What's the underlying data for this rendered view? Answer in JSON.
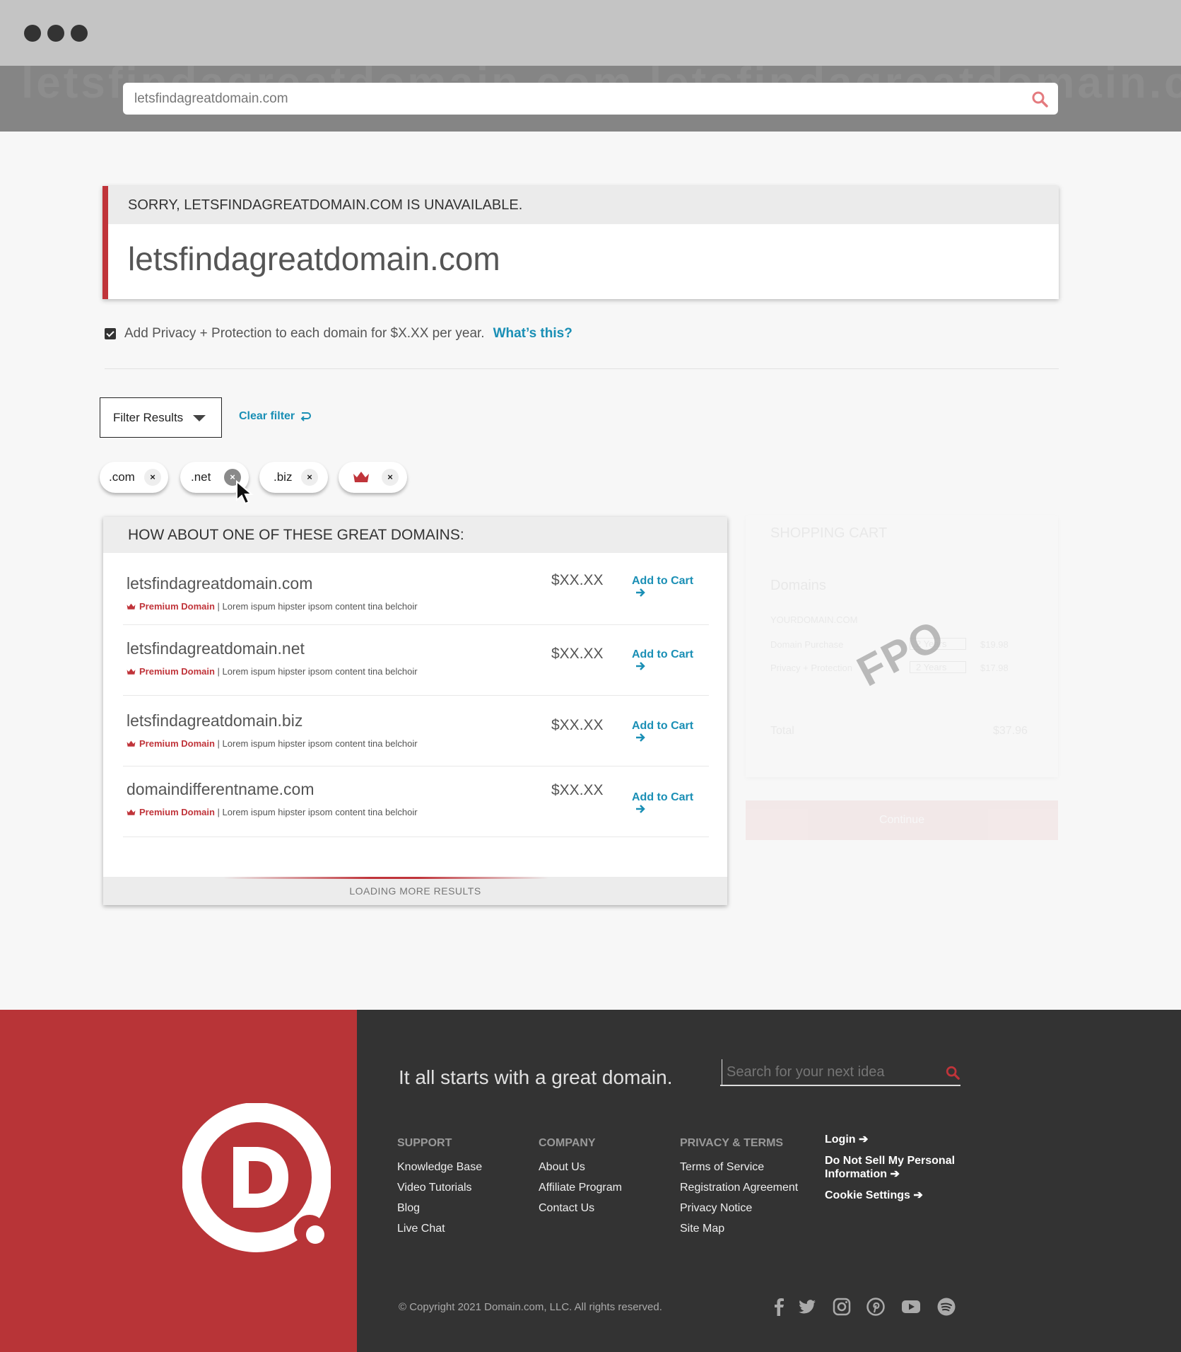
{
  "browser": {
    "url": "letsfindagreatdomain.com",
    "ghost_text": "letsfindagreatdomain.com letsfindagreatdomain.com letsfindagreatdomain.com"
  },
  "notice": {
    "header": "SORRY, LETSFINDAGREATDOMAIN.COM IS UNAVAILABLE.",
    "domain": "letsfindagreatdomain.com"
  },
  "privacy": {
    "checked": true,
    "text": "Add Privacy + Protection to each domain for $X.XX per year.",
    "link": "What’s this?"
  },
  "filter": {
    "button": "Filter Results",
    "clear": "Clear filter"
  },
  "chips": [
    {
      "label": ".com",
      "remove": "×"
    },
    {
      "label": ".net",
      "remove": "×"
    },
    {
      "label": ".biz",
      "remove": "×"
    },
    {
      "label": "",
      "icon": "crown-icon",
      "remove": "×"
    }
  ],
  "results": {
    "header": "HOW ABOUT ONE OF THESE GREAT DOMAINS:",
    "items": [
      {
        "domain": "letsfindagreatdomain.com",
        "badge": "Premium Domain",
        "desc": "| Lorem ispum hipster ipsom content tina belchoir",
        "price": "$XX.XX",
        "action": "Add to Cart"
      },
      {
        "domain": "letsfindagreatdomain.net",
        "badge": "Premium Domain",
        "desc": "| Lorem ispum hipster ipsom content tina belchoir",
        "price": "$XX.XX",
        "action": "Add to Cart"
      },
      {
        "domain": "letsfindagreatdomain.biz",
        "badge": "Premium Domain",
        "desc": "| Lorem ispum hipster ipsom content tina belchoir",
        "price": "$XX.XX",
        "action": "Add to Cart"
      },
      {
        "domain": "domaindifferentname.com",
        "badge": "Premium Domain",
        "desc": "| Lorem ispum hipster ipsom content tina belchoir",
        "price": "$XX.XX",
        "action": "Add to Cart"
      }
    ],
    "loading": "LOADING MORE RESULTS"
  },
  "cart": {
    "title": "SHOPPING CART",
    "section": "Domains",
    "domain": "YOURDOMAIN.COM",
    "lines": [
      {
        "label": "Domain Purchase",
        "term": "2 Years",
        "price": "$19.98"
      },
      {
        "label": "Privacy + Protection",
        "term": "2 Years",
        "price": "$17.98"
      }
    ],
    "total_label": "Total",
    "total": "$37.96",
    "continue": "Continue",
    "watermark": "FPO"
  },
  "footer": {
    "tagline": "It all starts with a great domain.",
    "search_placeholder": "Search for your next idea",
    "support": {
      "heading": "SUPPORT",
      "links": [
        "Knowledge Base",
        "Video Tutorials",
        "Blog",
        "Live Chat"
      ]
    },
    "company": {
      "heading": "COMPANY",
      "links": [
        "About Us",
        "Affiliate Program",
        "Contact Us"
      ]
    },
    "privacy": {
      "heading": "PRIVACY & TERMS",
      "links": [
        "Terms of Service",
        "Registration Agreement",
        "Privacy Notice",
        "Site Map"
      ]
    },
    "account": [
      "Login ➔",
      "Do Not Sell My Personal Information ➔",
      "Cookie Settings ➔"
    ],
    "copyright": "© Copyright 2021 Domain.com, LLC. All rights reserved.",
    "social": [
      "facebook-icon",
      "twitter-icon",
      "instagram-icon",
      "pinterest-icon",
      "youtube-icon",
      "spotify-icon"
    ]
  },
  "colors": {
    "brand_red": "#c0343a",
    "link_blue": "#1a8fb5",
    "footer_dark": "#333333",
    "footer_red": "#b83437"
  }
}
